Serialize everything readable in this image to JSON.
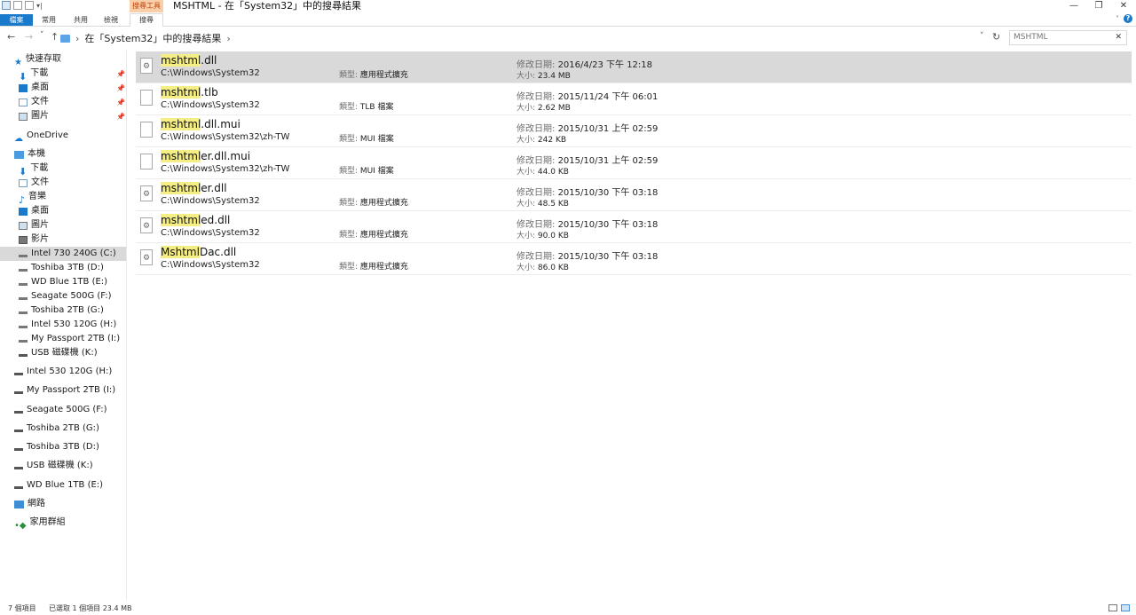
{
  "window": {
    "title": "MSHTML - 在「System32」中的搜尋結果",
    "context_tab_group": "搜尋工具",
    "controls": [
      "—",
      "❐",
      "✕"
    ]
  },
  "ribbon": {
    "tabs": [
      "檔案",
      "常用",
      "共用",
      "檢視",
      "搜尋"
    ],
    "accent_color": "#1979ca",
    "context_color": "#f8cfa8"
  },
  "address": {
    "back": "←",
    "forward": "→",
    "recent": "˅",
    "up": "↑",
    "path": "在「System32」中的搜尋結果",
    "sep1": "›",
    "sep2": "›",
    "dropdown": "˅",
    "refresh": "↻"
  },
  "search": {
    "value": "MSHTML",
    "clear": "✕"
  },
  "nav": {
    "quick_access": "快速存取",
    "quick_items": [
      "下載",
      "桌面",
      "文件",
      "圖片"
    ],
    "onedrive": "OneDrive",
    "this_pc": "本機",
    "pc_items": [
      "下載",
      "文件",
      "音樂",
      "桌面",
      "圖片",
      "影片"
    ],
    "drives": [
      "Intel 730 240G (C:)",
      "Toshiba 3TB (D:)",
      "WD Blue 1TB (E:)",
      "Seagate 500G (F:)",
      "Toshiba 2TB (G:)",
      "Intel 530 120G (H:)",
      "My Passport 2TB (I:)",
      "USB 磁碟機 (K:)"
    ],
    "removable": [
      "Intel 530 120G (H:)",
      "My Passport 2TB (I:)",
      "Seagate 500G (F:)",
      "Toshiba 2TB (G:)",
      "Toshiba 3TB (D:)",
      "USB 磁碟機 (K:)",
      "WD Blue 1TB (E:)"
    ],
    "network": "網路",
    "homegroup": "家用群組"
  },
  "labels": {
    "type": "類型:",
    "modified": "修改日期:",
    "size": "大小:"
  },
  "results": [
    {
      "match": "mshtml",
      "rest": ".dll",
      "path": "C:\\Windows\\System32",
      "type": "應用程式擴充",
      "date": "2016/4/23 下午 12:18",
      "size": "23.4 MB",
      "icon": "gear"
    },
    {
      "match": "mshtml",
      "rest": ".tlb",
      "path": "C:\\Windows\\System32",
      "type": "TLB 檔案",
      "date": "2015/11/24 下午 06:01",
      "size": "2.62 MB",
      "icon": "blank"
    },
    {
      "match": "mshtml",
      "rest": ".dll.mui",
      "path": "C:\\Windows\\System32\\zh-TW",
      "type": "MUI 檔案",
      "date": "2015/10/31 上午 02:59",
      "size": "242 KB",
      "icon": "blank"
    },
    {
      "match": "mshtml",
      "rest": "er.dll.mui",
      "path": "C:\\Windows\\System32\\zh-TW",
      "type": "MUI 檔案",
      "date": "2015/10/31 上午 02:59",
      "size": "44.0 KB",
      "icon": "blank"
    },
    {
      "match": "mshtml",
      "rest": "er.dll",
      "path": "C:\\Windows\\System32",
      "type": "應用程式擴充",
      "date": "2015/10/30 下午 03:18",
      "size": "48.5 KB",
      "icon": "gear"
    },
    {
      "match": "mshtml",
      "rest": "ed.dll",
      "path": "C:\\Windows\\System32",
      "type": "應用程式擴充",
      "date": "2015/10/30 下午 03:18",
      "size": "90.0 KB",
      "icon": "gear"
    },
    {
      "match": "Mshtml",
      "rest": "Dac.dll",
      "path": "C:\\Windows\\System32",
      "type": "應用程式擴充",
      "date": "2015/10/30 下午 03:18",
      "size": "86.0 KB",
      "icon": "gear"
    }
  ],
  "status": {
    "count": "7 個項目",
    "selected": "已選取 1 個項目  23.4 MB"
  }
}
